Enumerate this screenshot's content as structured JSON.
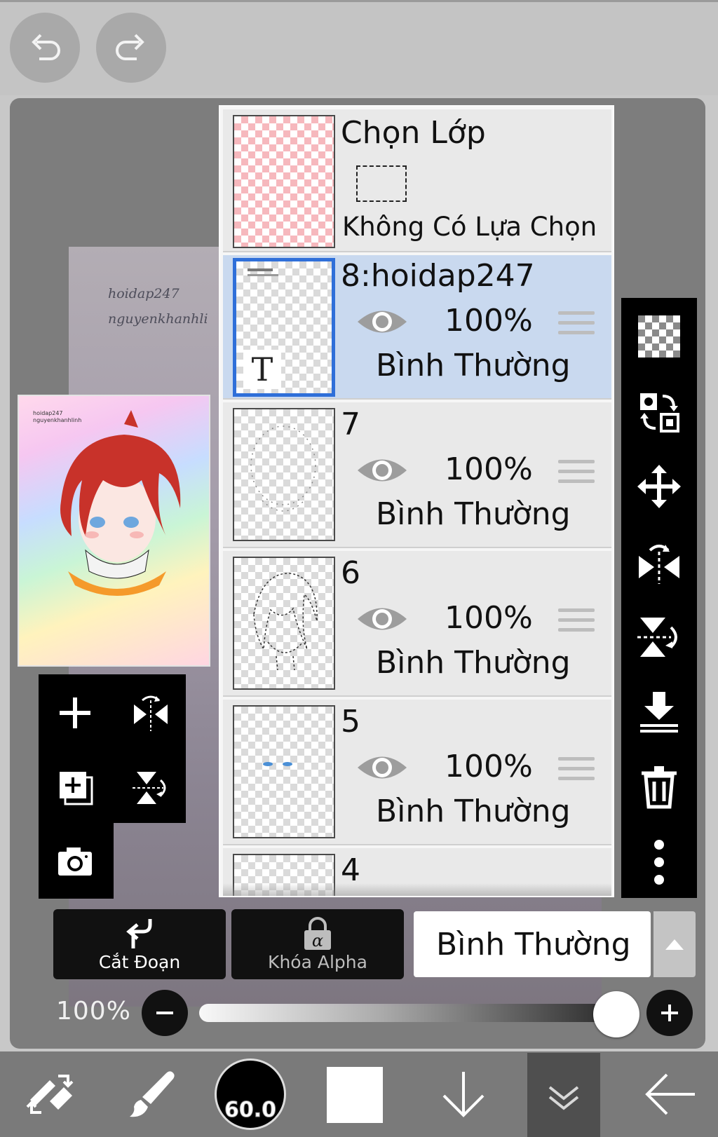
{
  "topbar": {
    "undo_icon": "undo-icon",
    "redo_icon": "redo-icon"
  },
  "canvas": {
    "watermark_line1": "hoidap247",
    "watermark_line2": "nguyenkhanhli"
  },
  "preview": {
    "line1": "hoidap247",
    "line2": "nguyenkhanhlinh"
  },
  "layers": {
    "selection": {
      "title": "Chọn Lớp",
      "subtitle": "Không Có Lựa Chọn"
    },
    "items": [
      {
        "name": "8:hoidap247",
        "opacity": "100%",
        "blend": "Bình Thường",
        "selected": true,
        "text_badge": "T"
      },
      {
        "name": "7",
        "opacity": "100%",
        "blend": "Bình Thường"
      },
      {
        "name": "6",
        "opacity": "100%",
        "blend": "Bình Thường"
      },
      {
        "name": "5",
        "opacity": "100%",
        "blend": "Bình Thường"
      },
      {
        "name": "4"
      }
    ]
  },
  "actions": {
    "clipping_label": "Cắt Đoạn",
    "alpha_lock_label": "Khóa Alpha",
    "blend_mode": "Bình Thường"
  },
  "opacity": {
    "label": "100%",
    "value": 1.0
  },
  "toolbar": {
    "brush_size": "60.0"
  },
  "colors": {
    "selected_layer": "#c9d9ef",
    "selection_border": "#2f6fd9"
  }
}
